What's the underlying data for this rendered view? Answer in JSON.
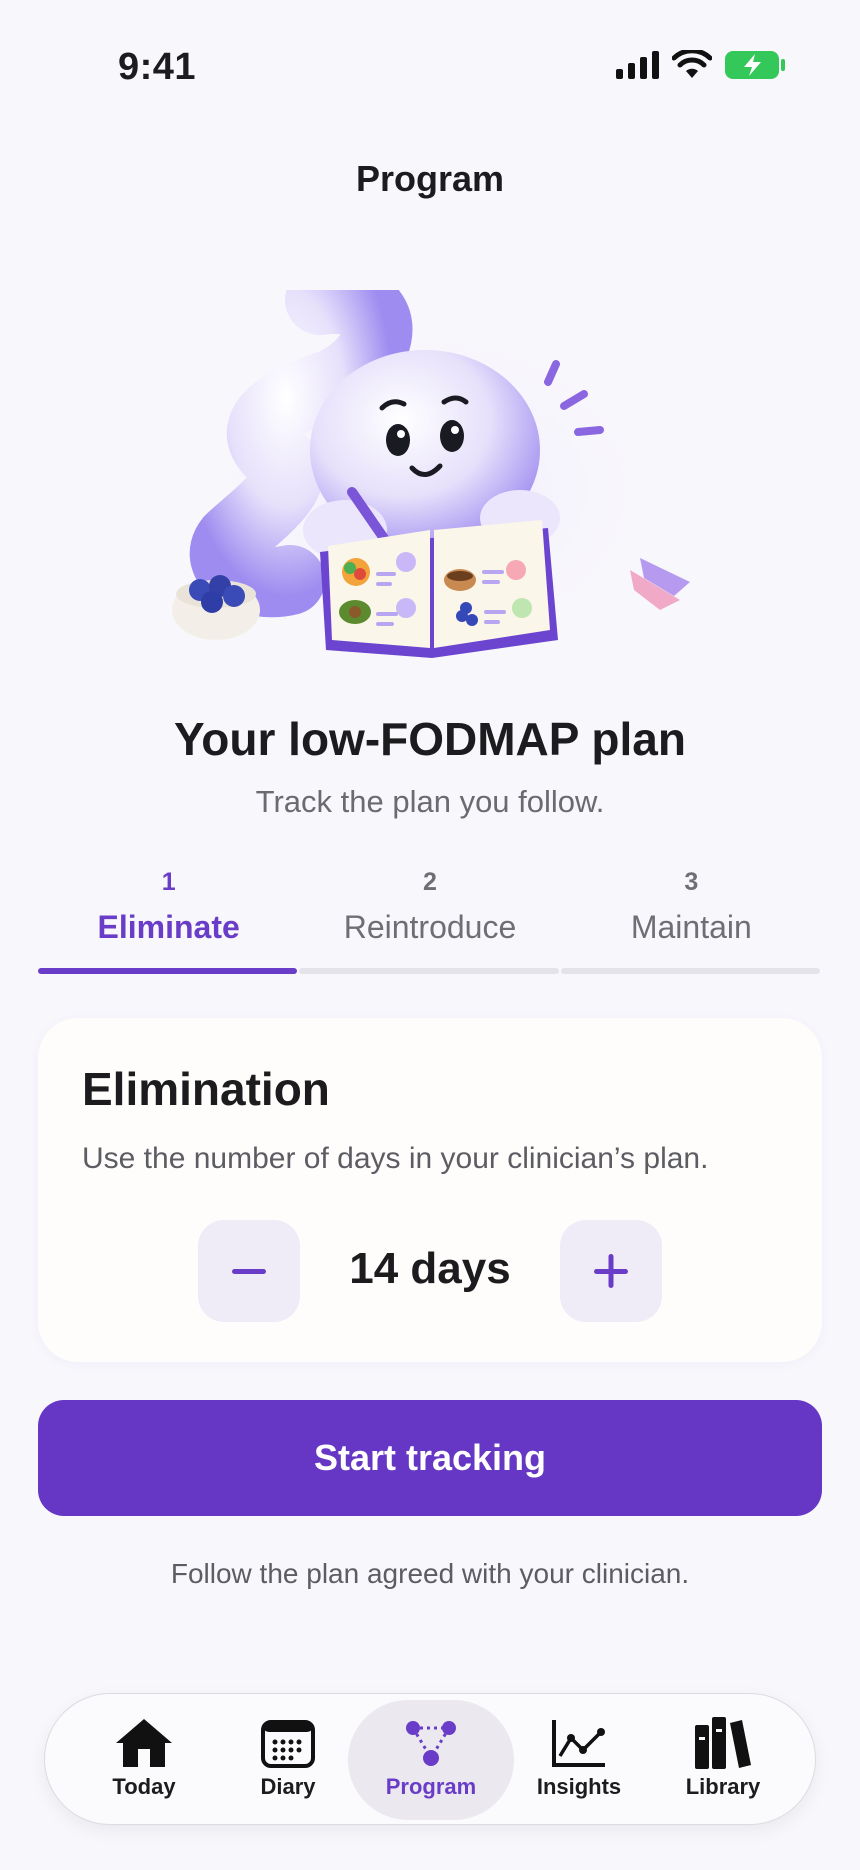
{
  "status_bar": {
    "time": "9:41"
  },
  "header": {
    "title": "Program"
  },
  "plan": {
    "title": "Your low-FODMAP plan",
    "subtitle": "Track the plan you follow."
  },
  "steps": [
    {
      "number": "1",
      "label": "Eliminate",
      "active": true
    },
    {
      "number": "2",
      "label": "Reintroduce",
      "active": false
    },
    {
      "number": "3",
      "label": "Maintain",
      "active": false
    }
  ],
  "card": {
    "title": "Elimination",
    "description": "Use the number of days in your clinician’s plan.",
    "value": "14 days"
  },
  "cta_label": "Start tracking",
  "footnote": "Follow the plan agreed with your clinician.",
  "tabs": [
    {
      "label": "Today",
      "icon": "house-icon"
    },
    {
      "label": "Diary",
      "icon": "calendar-icon"
    },
    {
      "label": "Program",
      "icon": "program-nodes-icon",
      "active": true
    },
    {
      "label": "Insights",
      "icon": "line-chart-icon"
    },
    {
      "label": "Library",
      "icon": "books-icon"
    }
  ],
  "colors": {
    "accent": "#6537c4",
    "background": "#f8f7fc",
    "card": "#fefdfc"
  }
}
